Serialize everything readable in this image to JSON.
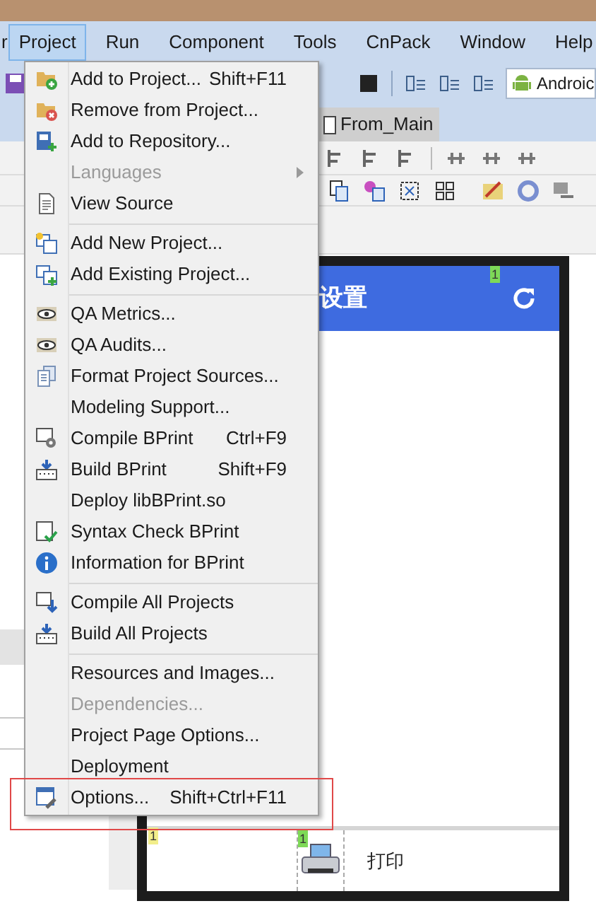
{
  "menubar": [
    {
      "label": "r",
      "selected": false
    },
    {
      "label": "Project",
      "selected": true
    },
    {
      "label": "Run",
      "selected": false
    },
    {
      "label": "Component",
      "selected": false
    },
    {
      "label": "Tools",
      "selected": false
    },
    {
      "label": "CnPack",
      "selected": false
    },
    {
      "label": "Window",
      "selected": false
    },
    {
      "label": "Help",
      "selected": false
    }
  ],
  "toolbar": {
    "platform_combo": "Androic"
  },
  "tabs": [
    {
      "label": "From_Main",
      "selected": true
    }
  ],
  "form": {
    "header_title": "设置",
    "print_label": "打印",
    "badges": [
      {
        "text": "1",
        "color": "#7ed957"
      },
      {
        "text": "1",
        "color": "#f2ee8a"
      },
      {
        "text": "1",
        "color": "#7ed957"
      }
    ]
  },
  "menu": {
    "items": [
      {
        "kind": "item",
        "label": "Add to Project...",
        "shortcut": "Shift+F11",
        "disabled": false,
        "submenu": false,
        "outlined": false
      },
      {
        "kind": "item",
        "label": "Remove from Project...",
        "disabled": false,
        "submenu": false,
        "outlined": false
      },
      {
        "kind": "item",
        "label": "Add to Repository...",
        "disabled": false,
        "submenu": false,
        "outlined": false
      },
      {
        "kind": "item",
        "label": "Languages",
        "disabled": true,
        "submenu": true,
        "outlined": false
      },
      {
        "kind": "item",
        "label": "View Source",
        "disabled": false,
        "submenu": false,
        "outlined": false
      },
      {
        "kind": "separator"
      },
      {
        "kind": "item",
        "label": "Add New Project...",
        "disabled": false,
        "submenu": false,
        "outlined": false
      },
      {
        "kind": "item",
        "label": "Add Existing Project...",
        "disabled": false,
        "submenu": false,
        "outlined": false
      },
      {
        "kind": "separator"
      },
      {
        "kind": "item",
        "label": "QA Metrics...",
        "disabled": false,
        "submenu": false,
        "outlined": false
      },
      {
        "kind": "item",
        "label": "QA Audits...",
        "disabled": false,
        "submenu": false,
        "outlined": false
      },
      {
        "kind": "item",
        "label": "Format Project Sources...",
        "disabled": false,
        "submenu": false,
        "outlined": false
      },
      {
        "kind": "item",
        "label": "Modeling Support...",
        "disabled": false,
        "submenu": false,
        "outlined": false
      },
      {
        "kind": "item",
        "label": "Compile BPrint",
        "shortcut": "Ctrl+F9",
        "disabled": false,
        "submenu": false,
        "outlined": false
      },
      {
        "kind": "item",
        "label": "Build BPrint",
        "shortcut": "Shift+F9",
        "disabled": false,
        "submenu": false,
        "outlined": false
      },
      {
        "kind": "item",
        "label": "Deploy libBPrint.so",
        "disabled": false,
        "submenu": false,
        "outlined": false
      },
      {
        "kind": "item",
        "label": "Syntax Check BPrint",
        "disabled": false,
        "submenu": false,
        "outlined": false
      },
      {
        "kind": "item",
        "label": "Information for BPrint",
        "disabled": false,
        "submenu": false,
        "outlined": false
      },
      {
        "kind": "separator"
      },
      {
        "kind": "item",
        "label": "Compile All Projects",
        "disabled": false,
        "submenu": false,
        "outlined": false
      },
      {
        "kind": "item",
        "label": "Build All Projects",
        "disabled": false,
        "submenu": false,
        "outlined": false
      },
      {
        "kind": "separator"
      },
      {
        "kind": "item",
        "label": "Resources and Images...",
        "disabled": false,
        "submenu": false,
        "outlined": false
      },
      {
        "kind": "item",
        "label": "Dependencies...",
        "disabled": true,
        "submenu": false,
        "outlined": false
      },
      {
        "kind": "item",
        "label": "Project Page Options...",
        "disabled": false,
        "submenu": false,
        "outlined": false
      },
      {
        "kind": "item",
        "label": "Deployment",
        "disabled": false,
        "submenu": false,
        "outlined": false
      },
      {
        "kind": "item",
        "label": "Options...",
        "shortcut": "Shift+Ctrl+F11",
        "disabled": false,
        "submenu": false,
        "outlined": true
      }
    ]
  }
}
